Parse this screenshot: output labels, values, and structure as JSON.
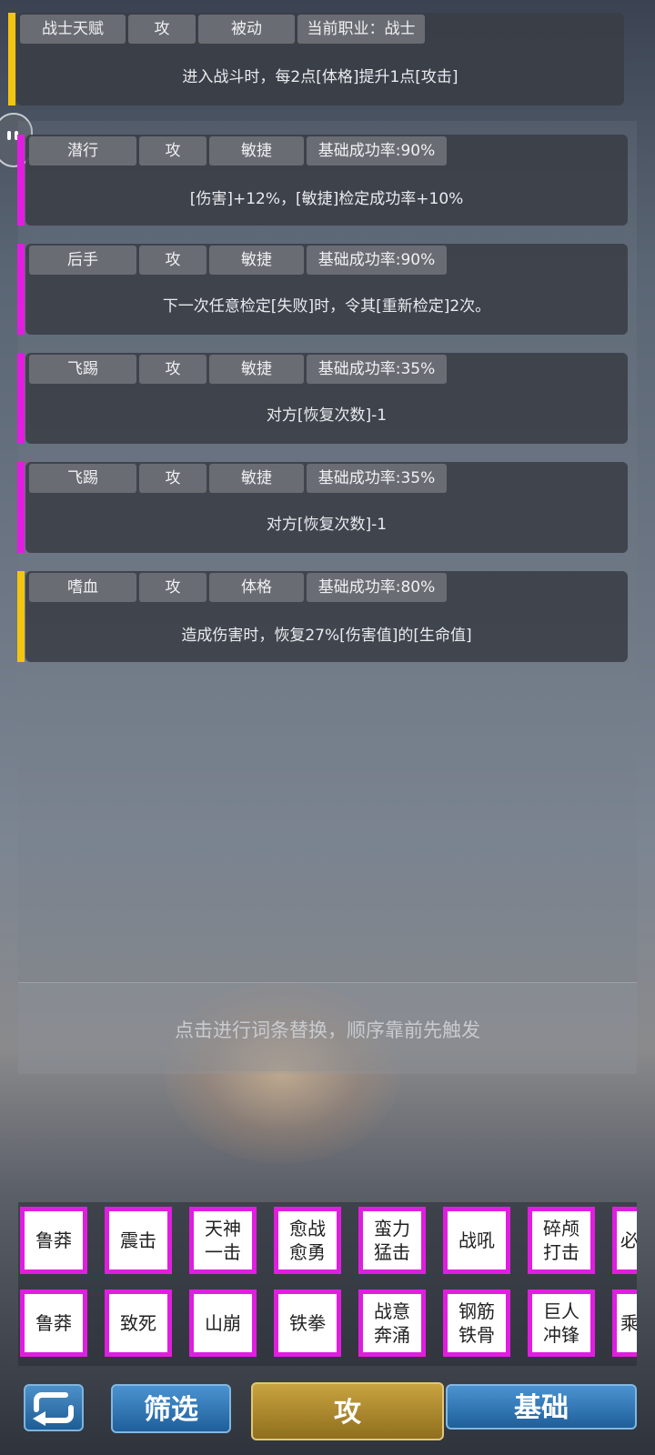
{
  "colors": {
    "talent_accent": "#f2c511",
    "skill_accent_magenta": "#e01ee0",
    "skill_accent_yellow": "#f2c511",
    "chip_border": "#e01ee0"
  },
  "talent_card": {
    "tags": [
      "战士天赋",
      "攻",
      "被动",
      "当前职业：战士"
    ],
    "desc": "进入战斗时，每2点[体格]提升1点[攻击]"
  },
  "skills": [
    {
      "tags": [
        "潜行",
        "攻",
        "敏捷",
        "基础成功率:90%"
      ],
      "desc": "[伤害]+12%，[敏捷]检定成功率+10%",
      "accent": "magenta"
    },
    {
      "tags": [
        "后手",
        "攻",
        "敏捷",
        "基础成功率:90%"
      ],
      "desc": "下一次任意检定[失败]时，令其[重新检定]2次。",
      "accent": "magenta"
    },
    {
      "tags": [
        "飞踢",
        "攻",
        "敏捷",
        "基础成功率:35%"
      ],
      "desc": "对方[恢复次数]-1",
      "accent": "magenta"
    },
    {
      "tags": [
        "飞踢",
        "攻",
        "敏捷",
        "基础成功率:35%"
      ],
      "desc": "对方[恢复次数]-1",
      "accent": "magenta"
    },
    {
      "tags": [
        "嗜血",
        "攻",
        "体格",
        "基础成功率:80%"
      ],
      "desc": "造成伤害时，恢复27%[伤害值]的[生命值]",
      "accent": "yellow"
    }
  ],
  "hint": "点击进行词条替换，顺序靠前先触发",
  "grid_row1": [
    "鲁莽",
    "震击",
    "天神一击",
    "愈战愈勇",
    "蛮力猛击",
    "战吼",
    "碎颅打击",
    "必"
  ],
  "grid_row2": [
    "鲁莽",
    "致死",
    "山崩",
    "铁拳",
    "战意奔涌",
    "钢筋铁骨",
    "巨人冲锋",
    "乘"
  ],
  "buttons": {
    "back_icon": "return-arrow-icon",
    "filter": "筛选",
    "attack": "攻",
    "base": "基础"
  }
}
